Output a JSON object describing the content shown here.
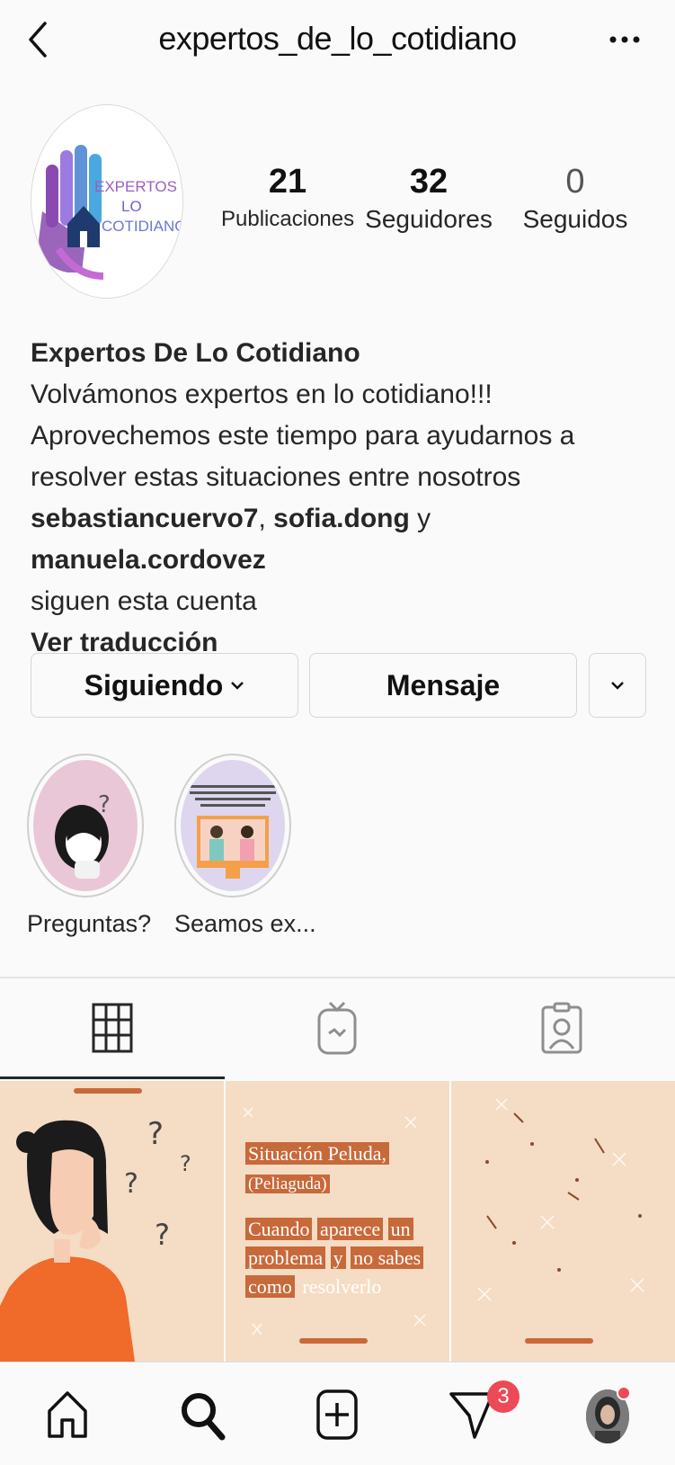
{
  "header": {
    "username": "expertos_de_lo_cotidiano"
  },
  "avatar": {
    "logo_line1": "EXPERTOS DE",
    "logo_line2": "LO",
    "logo_line3": "COTIDIANO"
  },
  "stats": {
    "posts": {
      "count": "21",
      "label": "Publicaciones"
    },
    "followers": {
      "count": "32",
      "label": "Seguidores"
    },
    "following": {
      "count": "0",
      "label": "Seguidos"
    }
  },
  "bio": {
    "name": "Expertos De Lo Cotidiano",
    "line1": "Volvámonos expertos en lo cotidiano!!!",
    "line2": "Aprovechemos este tiempo para ayudarnos a",
    "line3": "resolver estas situaciones entre nosotros",
    "follower1": "sebastiancuervo7",
    "sep1": ", ",
    "follower2": "sofia.dong",
    "sep2": " y ",
    "follower3": "manuela.cordovez",
    "followed_suffix": "siguen esta cuenta",
    "translate": "Ver traducción"
  },
  "actions": {
    "following": "Siguiendo",
    "message": "Mensaje"
  },
  "highlights": [
    {
      "label": "Preguntas?"
    },
    {
      "label": "Seamos ex..."
    }
  ],
  "posts": {
    "post2": {
      "title": "Situación Peluda,",
      "subtitle": "(Peliaguda)",
      "l1a": "Cuando",
      "l1b": "aparece",
      "l1c": "un",
      "l2a": "problema",
      "l2b": "y",
      "l2c": "no sabes",
      "l3a": "como",
      "l3b": "resolverlo"
    }
  },
  "nav": {
    "direct_badge": "3"
  },
  "colors": {
    "accent_badge": "#ed4956",
    "post_bg": "#f3d9c0",
    "post_label": "#c8693a"
  }
}
